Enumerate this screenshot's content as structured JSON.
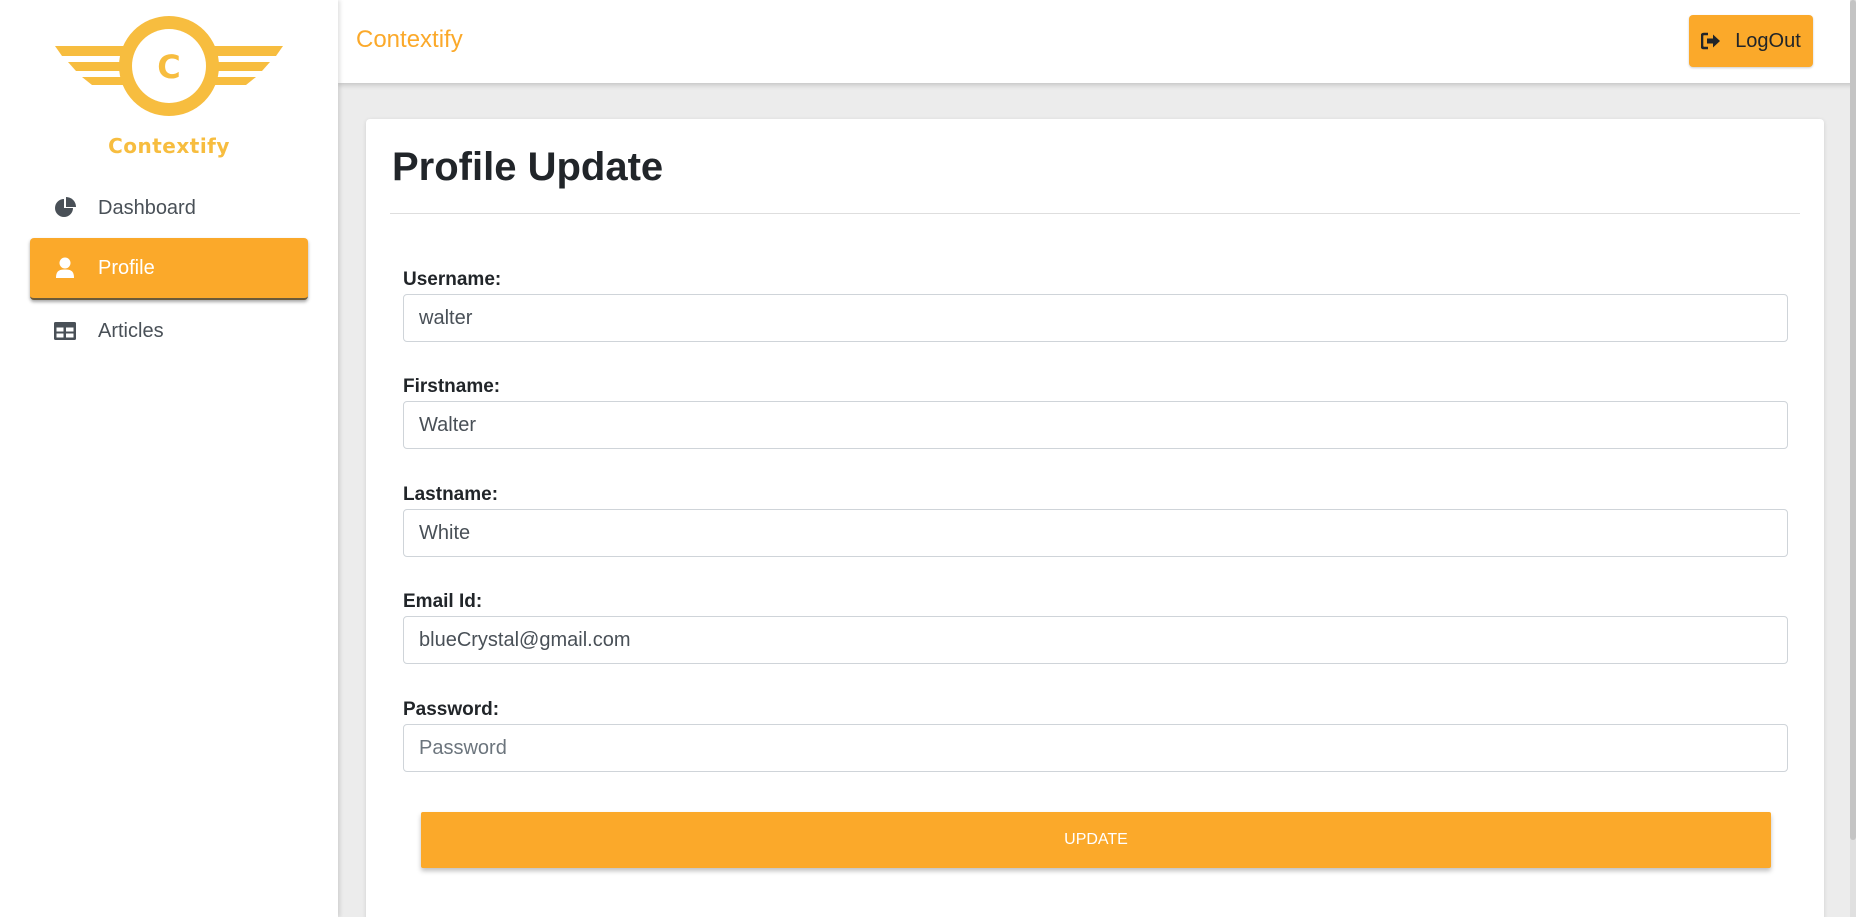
{
  "sidebar": {
    "logo": {
      "letter": "C",
      "text": "Contextify"
    },
    "items": [
      {
        "label": "Dashboard",
        "icon": "pie-chart-icon",
        "active": false
      },
      {
        "label": "Profile",
        "icon": "user-icon",
        "active": true
      },
      {
        "label": "Articles",
        "icon": "table-icon",
        "active": false
      }
    ]
  },
  "topbar": {
    "brand": "Contextify",
    "logout_label": "LogOut",
    "logout_icon": "sign-out-icon"
  },
  "form": {
    "title": "Profile Update",
    "fields": [
      {
        "label": "Username:",
        "value": "walter",
        "placeholder": ""
      },
      {
        "label": "Firstname:",
        "value": "Walter",
        "placeholder": ""
      },
      {
        "label": "Lastname:",
        "value": "White",
        "placeholder": ""
      },
      {
        "label": "Email Id:",
        "value": "blueCrystal@gmail.com",
        "placeholder": ""
      },
      {
        "label": "Password:",
        "value": "",
        "placeholder": "Password"
      }
    ],
    "submit_label": "UPDATE"
  },
  "colors": {
    "accent": "#fba92a",
    "logo": "#f7bd3f",
    "background": "#ececec"
  }
}
